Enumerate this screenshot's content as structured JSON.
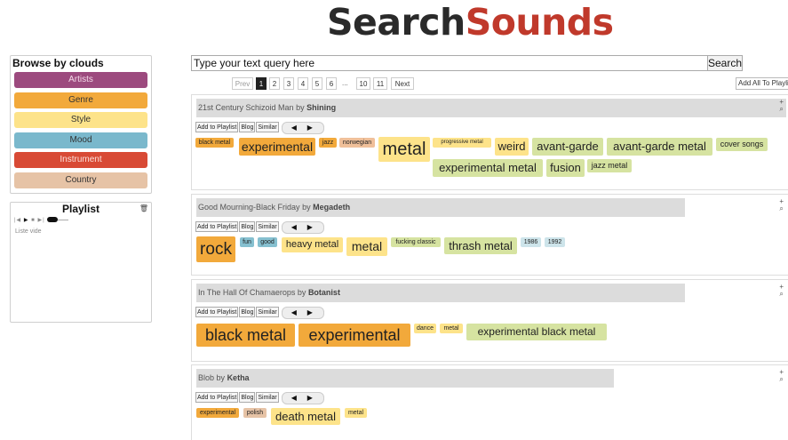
{
  "logo": {
    "part1": "Search",
    "part2": "Sounds"
  },
  "clouds": {
    "title": "Browse by clouds",
    "items": [
      {
        "label": "Artists",
        "color": "#9c4a7e"
      },
      {
        "label": "Genre",
        "color": "#f2a93b"
      },
      {
        "label": "Style",
        "color": "#fde38a"
      },
      {
        "label": "Mood",
        "color": "#7ab8cc"
      },
      {
        "label": "Instrument",
        "color": "#d84a35"
      },
      {
        "label": "Country",
        "color": "#e6c3a6"
      }
    ]
  },
  "playlist": {
    "title": "Playlist",
    "trash_icon": "trash-icon",
    "empty_text": "Liste vide"
  },
  "search": {
    "value": "Type your text query here",
    "button": "Search"
  },
  "pager": {
    "prev": "Prev",
    "pages": [
      "1",
      "2",
      "3",
      "4",
      "5",
      "6"
    ],
    "dots": "...",
    "later_pages": [
      "10",
      "11"
    ],
    "next": "Next",
    "active": "1"
  },
  "add_all": "Add All To Playlist",
  "result_buttons": {
    "add": "Add to Playlist",
    "blog": "Blog",
    "similar": "Similar"
  },
  "results": [
    {
      "title": "21st Century Schizoid Man",
      "by": "by",
      "artist": "Shining",
      "tags": [
        {
          "text": "black metal",
          "c": "orange"
        },
        {
          "text": "experimental",
          "c": "orange"
        },
        {
          "text": "jazz",
          "c": "orange"
        },
        {
          "text": "norwegian",
          "c": "salmon"
        },
        {
          "text": "metal",
          "c": "yellow"
        },
        {
          "text": "progressive metal",
          "c": "yellow"
        },
        {
          "text": "weird",
          "c": "yellow"
        },
        {
          "text": "avant-garde",
          "c": "green"
        },
        {
          "text": "avant-garde metal",
          "c": "green"
        },
        {
          "text": "cover songs",
          "c": "green"
        },
        {
          "text": "experimental metal",
          "c": "green"
        },
        {
          "text": "fusion",
          "c": "green"
        },
        {
          "text": "jazz metal",
          "c": "green"
        }
      ]
    },
    {
      "title": "Good Mourning-Black Friday",
      "by": "by",
      "artist": "Megadeth",
      "tags": [
        {
          "text": "rock",
          "c": "orange"
        },
        {
          "text": "fun",
          "c": "blue"
        },
        {
          "text": "good",
          "c": "blue"
        },
        {
          "text": "heavy metal",
          "c": "yellow"
        },
        {
          "text": "metal",
          "c": "yellow"
        },
        {
          "text": "fucking classic",
          "c": "green"
        },
        {
          "text": "thrash metal",
          "c": "green"
        },
        {
          "text": "1986",
          "c": "lblue"
        },
        {
          "text": "1992",
          "c": "lblue"
        }
      ]
    },
    {
      "title": "In The Hall Of Chamaerops",
      "by": "by",
      "artist": "Botanist",
      "tags": [
        {
          "text": "black metal",
          "c": "orange"
        },
        {
          "text": "experimental",
          "c": "orange"
        },
        {
          "text": "dance",
          "c": "yellow"
        },
        {
          "text": "metal",
          "c": "yellow"
        },
        {
          "text": "experimental black metal",
          "c": "green"
        }
      ]
    },
    {
      "title": "Blob",
      "by": "by",
      "artist": "Ketha",
      "tags": [
        {
          "text": "experimental",
          "c": "orange"
        },
        {
          "text": "polish",
          "c": "tan"
        },
        {
          "text": "death metal",
          "c": "yellow"
        },
        {
          "text": "metal",
          "c": "yellow"
        }
      ]
    }
  ]
}
